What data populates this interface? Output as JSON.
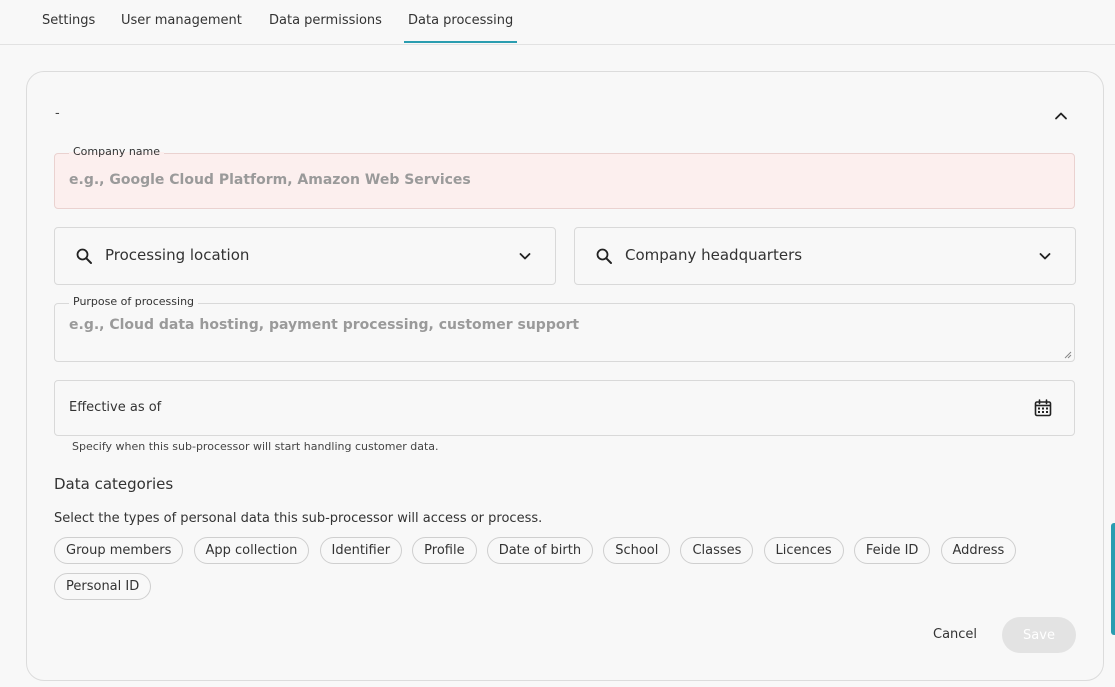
{
  "tabs": [
    {
      "label": "Settings",
      "active": false
    },
    {
      "label": "User management",
      "active": false
    },
    {
      "label": "Data permissions",
      "active": false
    },
    {
      "label": "Data processing",
      "active": true
    }
  ],
  "card": {
    "title": "-",
    "collapse_icon": "chevron-up-icon",
    "company_name": {
      "label": "Company name",
      "placeholder": "e.g., Google Cloud Platform, Amazon Web Services",
      "value": ""
    },
    "processing_location": {
      "placeholder": "Processing location",
      "icon": "search-icon",
      "dropdown_icon": "chevron-down-icon"
    },
    "company_headquarters": {
      "placeholder": "Company headquarters",
      "icon": "search-icon",
      "dropdown_icon": "chevron-down-icon"
    },
    "purpose": {
      "label": "Purpose of processing",
      "placeholder": "e.g., Cloud data hosting, payment processing, customer support",
      "value": ""
    },
    "effective_date": {
      "label": "Effective as of",
      "icon": "calendar-icon",
      "helper": "Specify when this sub-processor will start handling customer data."
    },
    "data_categories": {
      "title": "Data categories",
      "description": "Select the types of personal data this sub-processor will access or process.",
      "chips": [
        "Group members",
        "App collection",
        "Identifier",
        "Profile",
        "Date of birth",
        "School",
        "Classes",
        "Licences",
        "Feide ID",
        "Address",
        "Personal ID"
      ]
    },
    "actions": {
      "cancel_label": "Cancel",
      "save_label": "Save"
    }
  },
  "colors": {
    "accent": "#2a9db0",
    "error_bg": "#fcefee",
    "disabled_button": "#e3e3e3"
  }
}
